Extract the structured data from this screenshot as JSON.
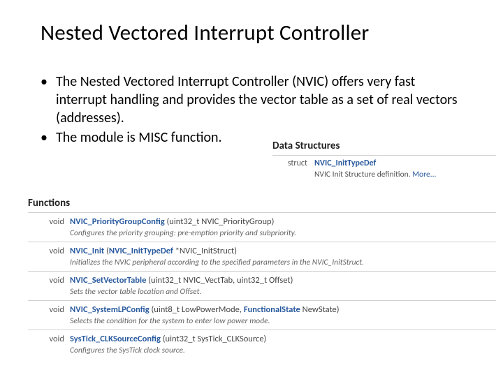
{
  "title": "Nested Vectored Interrupt Controller",
  "bullets": [
    "The Nested Vectored Interrupt Controller (NVIC) offers very fast interrupt handling and provides the vector table as a set of real vectors (addresses).",
    "The module is MISC function."
  ],
  "dataStructures": {
    "heading": "Data Structures",
    "keyword": "struct",
    "typeName": "NVIC_InitTypeDef",
    "desc": "NVIC Init Structure definition.",
    "more": "More..."
  },
  "functions": {
    "heading": "Functions",
    "items": [
      {
        "ret": "void",
        "name": "NVIC_PriorityGroupConfig",
        "params": " (uint32_t NVIC_PriorityGroup)",
        "desc": "Configures the priority grouping: pre-emption priority and subpriority."
      },
      {
        "ret": "void",
        "name": "NVIC_Init",
        "paramsPrefix": " (",
        "paramType": "NVIC_InitTypeDef",
        "paramsSuffix": " *NVIC_InitStruct)",
        "desc": "Initializes the NVIC peripheral according to the specified parameters in the NVIC_InitStruct."
      },
      {
        "ret": "void",
        "name": "NVIC_SetVectorTable",
        "params": " (uint32_t NVIC_VectTab, uint32_t Offset)",
        "desc": "Sets the vector table location and Offset."
      },
      {
        "ret": "void",
        "name": "NVIC_SystemLPConfig",
        "paramsPrefix": " (uint8_t LowPowerMode, ",
        "paramType": "FunctionalState",
        "paramsSuffix": " NewState)",
        "desc": "Selects the condition for the system to enter low power mode."
      },
      {
        "ret": "void",
        "name": "SysTick_CLKSourceConfig",
        "params": " (uint32_t SysTick_CLKSource)",
        "desc": "Configures the SysTick clock source."
      }
    ]
  }
}
